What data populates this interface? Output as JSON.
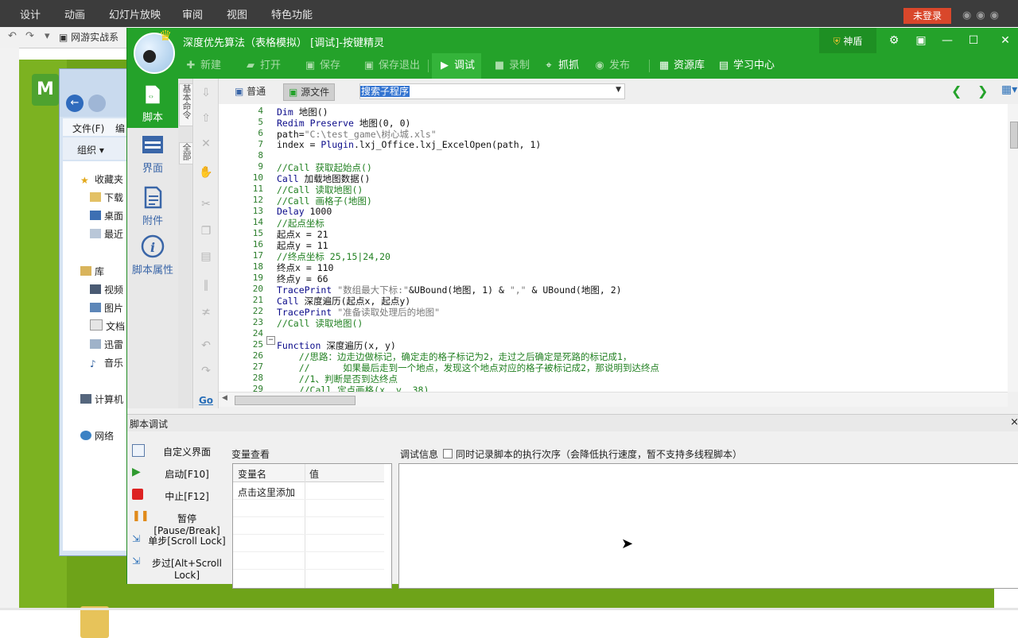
{
  "background_app": {
    "menu": [
      "设计",
      "动画",
      "幻灯片放映",
      "审阅",
      "视图",
      "特色功能"
    ],
    "login_button": "未登录",
    "quick_icons": [
      "↶",
      "↷",
      "▾"
    ],
    "tab_title": "网游实战系"
  },
  "explorer": {
    "menu_file": "文件(F)",
    "menu_edit": "编",
    "organize": "组织 ▾",
    "tree": [
      "收藏夹",
      "下载",
      "桌面",
      "最近",
      "库",
      "视频",
      "图片",
      "文档",
      "迅雷",
      "音乐",
      "计算机",
      "网络"
    ]
  },
  "app": {
    "title": "深度优先算法（表格模拟） [调试]-按键精灵",
    "shield": "神盾",
    "toolbar": {
      "new": "新建",
      "open": "打开",
      "save": "保存",
      "save_exit": "保存退出",
      "debug": "调试",
      "record": "录制",
      "grab": "抓抓",
      "publish": "发布",
      "resources": "资源库",
      "learning": "学习中心"
    },
    "nav": {
      "script": "脚本",
      "ui": "界面",
      "attachment": "附件",
      "properties": "脚本属性"
    },
    "side_tabs": [
      "基本命令",
      "全部"
    ],
    "view_tabs": {
      "normal": "普通",
      "source": "源文件"
    },
    "search": {
      "placeholder": "搜索子程序"
    },
    "edit_go": "Go"
  },
  "code_lines": [
    {
      "n": "4",
      "t": "Dim 地图()"
    },
    {
      "n": "5",
      "t": "Redim Preserve 地图(0, 0)"
    },
    {
      "n": "6",
      "t": "path=\"C:\\test_game\\树心城.xls\""
    },
    {
      "n": "7",
      "t": "index = Plugin.lxj_Office.lxj_ExcelOpen(path, 1)"
    },
    {
      "n": "8",
      "t": ""
    },
    {
      "n": "9",
      "t": "//Call 获取起始点()"
    },
    {
      "n": "10",
      "t": "Call 加载地图数据()"
    },
    {
      "n": "11",
      "t": "//Call 读取地图()"
    },
    {
      "n": "12",
      "t": "//Call 画格子(地图)"
    },
    {
      "n": "13",
      "t": "Delay 1000"
    },
    {
      "n": "14",
      "t": "//起点坐标"
    },
    {
      "n": "15",
      "t": "起点x = 21"
    },
    {
      "n": "16",
      "t": "起点y = 11"
    },
    {
      "n": "17",
      "t": "//终点坐标 25,15|24,20"
    },
    {
      "n": "18",
      "t": "终点x = 110"
    },
    {
      "n": "19",
      "t": "终点y = 66"
    },
    {
      "n": "20",
      "t": "TracePrint \"数组最大下标:\"&UBound(地图, 1) & \",\" & UBound(地图, 2)"
    },
    {
      "n": "21",
      "t": "Call 深度遍历(起点x, 起点y)"
    },
    {
      "n": "22",
      "t": "TracePrint \"准备读取处理后的地图\""
    },
    {
      "n": "23",
      "t": "//Call 读取地图()"
    },
    {
      "n": "24",
      "t": ""
    },
    {
      "n": "25",
      "t": "Function 深度遍历(x, y)"
    },
    {
      "n": "26",
      "t": "    //思路：边走边做标记，确定走的格子标记为2，走过之后确定是死路的标记成1，"
    },
    {
      "n": "27",
      "t": "    //      如果最后走到一个地点，发现这个地点对应的格子被标记成2，那说明到达终点"
    },
    {
      "n": "28",
      "t": "    //1、判断是否到达终点"
    },
    {
      "n": "29",
      "t": "    //Call 定点画格(x, y, 38)"
    }
  ],
  "debug": {
    "title": "脚本调试",
    "close": "×",
    "buttons": [
      "自定义界面",
      "启动[F10]",
      "中止[F12]",
      "暂停[Pause/Break]",
      "单步[Scroll Lock]",
      "步过[Alt+Scroll Lock]"
    ],
    "var_title": "变量查看",
    "var_col_name": "变量名",
    "var_col_value": "值",
    "var_add": "点击这里添加",
    "info_label": "调试信息",
    "info_option": "同时记录脚本的执行次序（会降低执行速度，暂不支持多线程脚本）"
  },
  "colors": {
    "accent": "#24a22a",
    "slide": "#6ea319",
    "login": "#d9472b"
  }
}
